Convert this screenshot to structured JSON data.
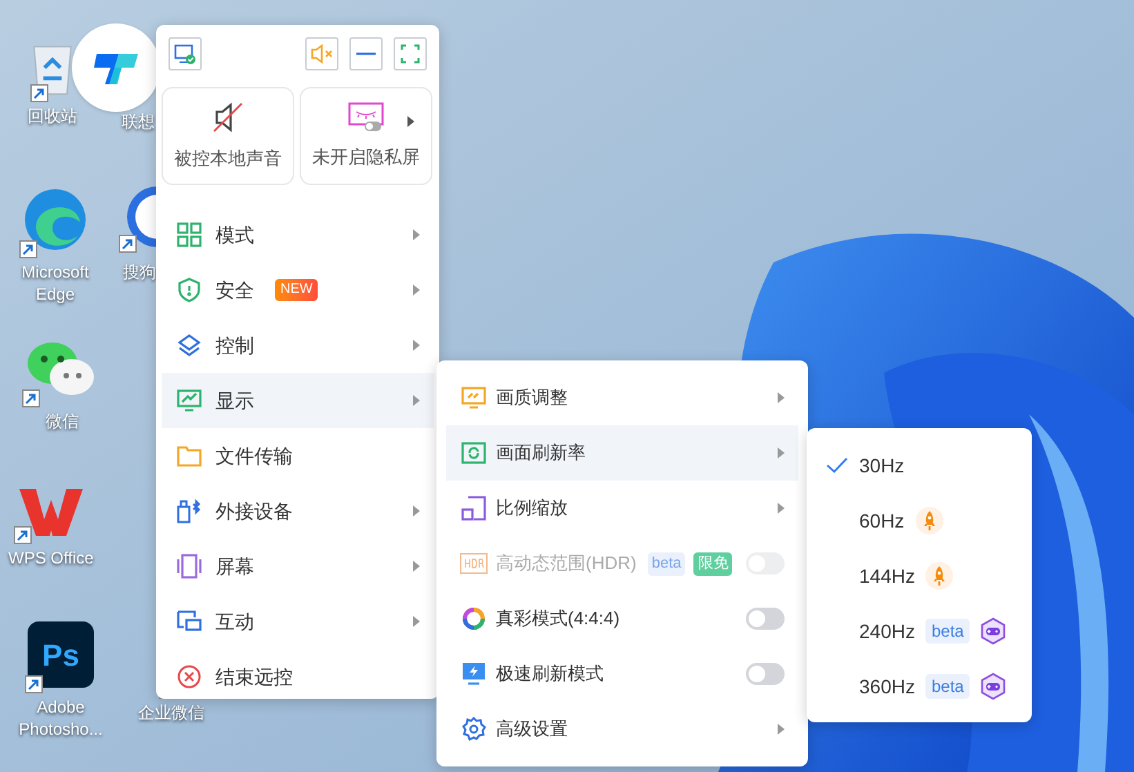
{
  "desktop_icons": [
    {
      "label": "回收站",
      "kind": "recycle"
    },
    {
      "label": "联想",
      "kind": "hidden"
    },
    {
      "label": "Microsoft Edge",
      "kind": "edge"
    },
    {
      "label": "搜狗",
      "kind": "sogou"
    },
    {
      "label": "微信",
      "kind": "wechat"
    },
    {
      "label": "WPS Office",
      "kind": "wps"
    },
    {
      "label": "Adobe Photosho...",
      "kind": "ps",
      "icon_text": "Ps"
    },
    {
      "label": "企业微信",
      "kind": "wecom"
    }
  ],
  "quick_actions": [
    {
      "label": "被控本地声音",
      "kind": "sound",
      "has_arrow": false
    },
    {
      "label": "未开启隐私屏",
      "kind": "privacy",
      "has_arrow": true
    }
  ],
  "menu": [
    {
      "label": "模式",
      "submenu": true,
      "selected": false
    },
    {
      "label": "安全",
      "submenu": true,
      "selected": false,
      "badge": "NEW"
    },
    {
      "label": "控制",
      "submenu": true,
      "selected": false
    },
    {
      "label": "显示",
      "submenu": true,
      "selected": true
    },
    {
      "label": "文件传输",
      "submenu": false,
      "selected": false
    },
    {
      "label": "外接设备",
      "submenu": true,
      "selected": false
    },
    {
      "label": "屏幕",
      "submenu": true,
      "selected": false
    },
    {
      "label": "互动",
      "submenu": true,
      "selected": false
    },
    {
      "label": "结束远控",
      "submenu": false,
      "selected": false
    }
  ],
  "display_submenu": [
    {
      "label": "画质调整",
      "kind": "submenu",
      "selected": false
    },
    {
      "label": "画面刷新率",
      "kind": "submenu",
      "selected": true
    },
    {
      "label": "比例缩放",
      "kind": "submenu",
      "selected": false
    },
    {
      "label": "高动态范围(HDR)",
      "kind": "toggle",
      "disabled": true,
      "on": false,
      "badges": [
        {
          "text": "beta",
          "kind": "beta"
        },
        {
          "text": "限免",
          "kind": "free"
        }
      ]
    },
    {
      "label": "真彩模式(4:4:4)",
      "kind": "toggle",
      "disabled": false,
      "on": false
    },
    {
      "label": "极速刷新模式",
      "kind": "toggle",
      "disabled": false,
      "on": false
    },
    {
      "label": "高级设置",
      "kind": "submenu",
      "selected": false
    }
  ],
  "refresh_rates": [
    {
      "label": "30Hz",
      "selected": true,
      "kind": "plain"
    },
    {
      "label": "60Hz",
      "selected": false,
      "kind": "boost"
    },
    {
      "label": "144Hz",
      "selected": false,
      "kind": "boost"
    },
    {
      "label": "240Hz",
      "selected": false,
      "kind": "game",
      "badge": "beta"
    },
    {
      "label": "360Hz",
      "selected": false,
      "kind": "game",
      "badge": "beta"
    }
  ]
}
